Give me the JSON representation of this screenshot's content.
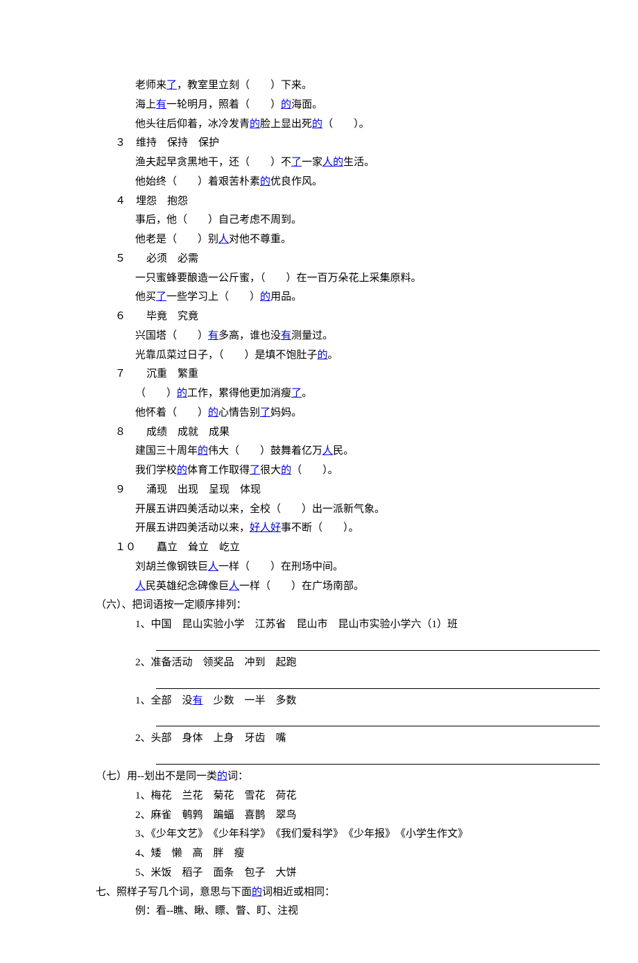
{
  "s2": {
    "a": {
      "t1": "老师来",
      "l1": "了",
      "t2": "，教室里立刻（　　）下来。"
    },
    "b": {
      "t1": "海上",
      "l1": "有",
      "t2": "一轮明月，照着（　　）",
      "l2": "的",
      "t3": "海面。"
    },
    "c": {
      "t1": "他头往后仰着，冰冷发青",
      "l1": "的",
      "t2": "脸上显出死",
      "l2": "的",
      "t3": "（　　）。"
    }
  },
  "s3": {
    "h": "３　维持　保持　保护",
    "a": {
      "t1": "渔夫起早贪黑地干，还（　　）不",
      "l1": "了",
      "t2": "一家",
      "l2": "人",
      "l3": "的",
      "t3": "生活。"
    },
    "b": {
      "t1": "他始终（　　）着艰苦朴素",
      "l1": "的",
      "t2": "优良作风。"
    }
  },
  "s4": {
    "h": "４　埋怨　抱怨",
    "a": "事后，他（　　）自己考虑不周到。",
    "b": {
      "t1": "他老是（　　）别",
      "l1": "人",
      "t2": "对他不尊重。"
    }
  },
  "s5": {
    "h": "５　　必须　必需",
    "a": "一只蜜蜂要酿造一公斤蜜，（　　）在一百万朵花上采集原料。",
    "b": {
      "t1": "他买",
      "l1": "了",
      "t2": "一些学习上（　　）",
      "l2": "的",
      "t3": "用品。"
    }
  },
  "s6": {
    "h": "６　　毕竟　究竟",
    "a": {
      "t1": "兴国塔（　　）",
      "l1": "有",
      "t2": "多高，谁也没",
      "l2": "有",
      "t3": "测量过。"
    },
    "b": {
      "t1": "光靠瓜菜过日子，（　　）是填不饱肚子",
      "l1": "的",
      "t2": "。"
    }
  },
  "s7": {
    "h": "７　　沉重　繁重",
    "a": {
      "t1": "（　　）",
      "l1": "的",
      "t2": "工作，累得他更加消瘦",
      "l2": "了",
      "t3": "。"
    },
    "b": {
      "t1": "他怀着（　　）",
      "l1": "的",
      "t2": "心情告别",
      "l2": "了",
      "t3": "妈妈。"
    }
  },
  "s8": {
    "h": "８　　成绩　成就　成果",
    "a": {
      "t1": "建国三十周年",
      "l1": "的",
      "t2": "伟大（　　）鼓舞着亿万",
      "l2": "人",
      "t3": "民。"
    },
    "b": {
      "t1": "我们学校",
      "l1": "的",
      "t2": "体育工作取得",
      "l2": "了",
      "t3": "很大",
      "l3": "的",
      "t4": "（　　）。"
    }
  },
  "s9": {
    "h": "９　　涌现　出现　呈现　体现",
    "a": "开展五讲四美活动以来，全校（　　）出一派新气象。",
    "b": {
      "t1": "开展五讲四美活动以来，",
      "l1": "好人好",
      "t2": "事不断（　　）。"
    }
  },
  "s10": {
    "h": "１０　　矗立　耸立　屹立",
    "a": {
      "t1": "刘胡兰像钢铁巨",
      "l1": "人",
      "t2": "一样（　　）在刑场中间。"
    },
    "b": {
      "l1": "人",
      "t1": "民英雄纪念碑像巨",
      "l2": "人",
      "t2": "一样（　　）在广场南部。"
    }
  },
  "sec6": {
    "h": "（六）、把词语按一定顺序排列：",
    "i1": "1、中国　昆山实验小学　江苏省　昆山市　昆山市实验小学六（1）班",
    "i2": "2、准备活动　领奖品　冲到　起跑",
    "i3": {
      "t1": "1、全部　没",
      "l1": "有",
      "t2": "　少数　一半　多数"
    },
    "i4": "2、头部　身体　上身　牙齿　嘴"
  },
  "sec7": {
    "h": {
      "t1": "（七）用--划出不是同一类",
      "l1": "的",
      "t2": "词："
    },
    "i1": "1、梅花　兰花　菊花　雪花　荷花",
    "i2": "2、麻雀　鹌鹑　蹁蝠　喜鹊　翠鸟",
    "i3": "3、《少年文艺》　《少年科学》　《我们爱科学》　《少年报》　《小学生作文》",
    "i4": "4、矮　懒　高　胖　瘦",
    "i5": "5、米饭　稻子　面条　包子　大饼"
  },
  "sec_seven": {
    "h": {
      "t1": "七、照样子写几个词，意思与下面",
      "l1": "的",
      "t2": "词相近或相同："
    },
    "ex": "例：看--瞧、瞅、瞟、瞥、盯、注视"
  }
}
